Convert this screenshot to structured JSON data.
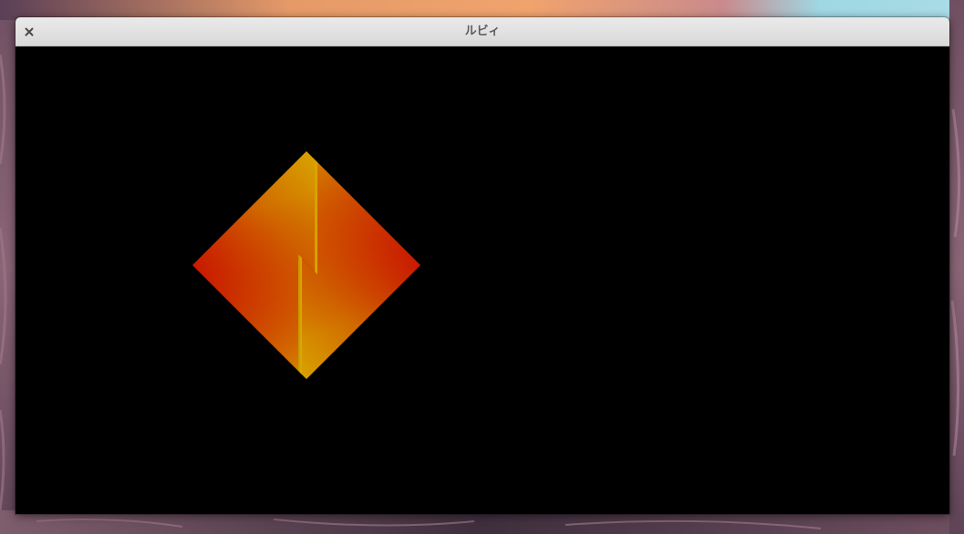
{
  "window": {
    "title": "ルビィ",
    "close_icon": "close-icon"
  },
  "canvas": {
    "background": "#000000",
    "shape": "diamond-with-zigzag-split",
    "colors": {
      "edge_gold": "#d7a800",
      "mid_orange": "#d97800",
      "center_red": "#cc1200"
    }
  }
}
